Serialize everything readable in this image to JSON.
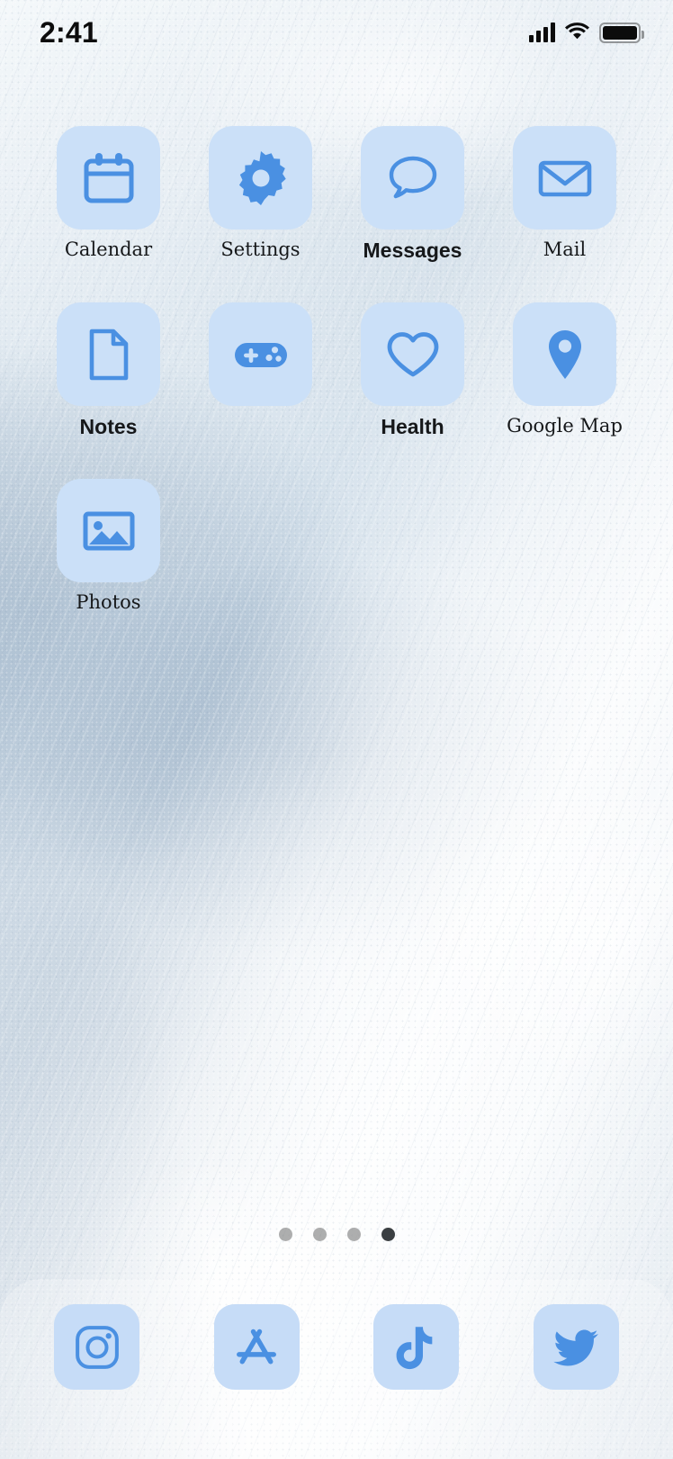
{
  "theme": {
    "tile_color": "#cbe0f8",
    "dock_tile_color": "#c6dcf7",
    "glyph_color": "#4a90e2",
    "label_color": "#16181a",
    "dot_active_color": "#3b3f42",
    "dot_inactive_color": "#7c7c7c"
  },
  "status_bar": {
    "time": "2:41",
    "cellular_icon": "signal-bars-icon",
    "wifi_icon": "wifi-icon",
    "battery_icon": "battery-full-icon"
  },
  "home_screen": {
    "apps": [
      {
        "label": "Calendar",
        "icon": "calendar-icon",
        "font": "serif"
      },
      {
        "label": "Settings",
        "icon": "gear-icon",
        "font": "serif"
      },
      {
        "label": "Messages",
        "icon": "speech-bubble-icon",
        "font": "sans"
      },
      {
        "label": "Mail",
        "icon": "envelope-icon",
        "font": "serif"
      },
      {
        "label": "Notes",
        "icon": "document-icon",
        "font": "sans"
      },
      {
        "label": "",
        "icon": "game-controller-icon",
        "font": "sans"
      },
      {
        "label": "Health",
        "icon": "heart-icon",
        "font": "sans"
      },
      {
        "label": "Google Map",
        "icon": "map-pin-icon",
        "font": "serif"
      },
      {
        "label": "Photos",
        "icon": "photo-icon",
        "font": "serif"
      }
    ]
  },
  "page_indicator": {
    "total_pages": 4,
    "current_page": 4
  },
  "dock": {
    "apps": [
      {
        "label": "Instagram",
        "icon": "instagram-icon"
      },
      {
        "label": "App Store",
        "icon": "app-store-icon"
      },
      {
        "label": "TikTok",
        "icon": "tiktok-icon"
      },
      {
        "label": "Twitter",
        "icon": "twitter-icon"
      }
    ]
  }
}
